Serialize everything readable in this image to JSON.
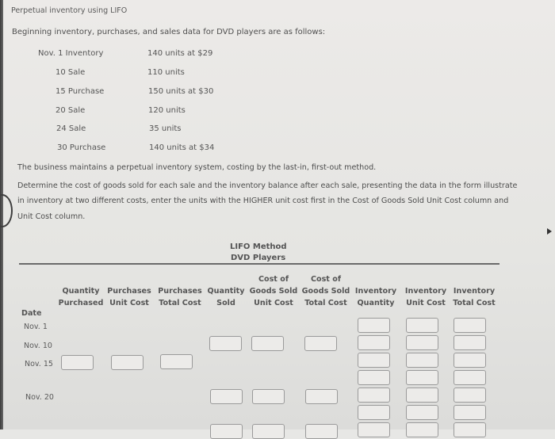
{
  "title": "Perpetual inventory using LIFO",
  "intro": "Beginning inventory, purchases, and sales data for DVD players are as follows:",
  "events": [
    {
      "date": "Nov. 1 Inventory",
      "detail": "140 units at $29"
    },
    {
      "date": "10 Sale",
      "detail": "110 units"
    },
    {
      "date": "15 Purchase",
      "detail": "150 units at $30"
    },
    {
      "date": "20 Sale",
      "detail": "120 units"
    },
    {
      "date": "24 Sale",
      "detail": "35 units"
    },
    {
      "date": "30 Purchase",
      "detail": "140 units at $34"
    }
  ],
  "paragraph1": "The business maintains a perpetual inventory system, costing by the last-in, first-out method.",
  "paragraph2_lines": [
    "Determine the cost of goods sold for each sale and the inventory balance after each sale, presenting the data in the form illustrate",
    "in inventory at two different costs, enter the units with the HIGHER unit cost first in the Cost of Goods Sold Unit Cost column and",
    "Unit Cost column."
  ],
  "table": {
    "title": "LIFO Method",
    "subtitle": "DVD Players",
    "columns": {
      "date": "Date",
      "qty_purchased": [
        "Quantity",
        "Purchased"
      ],
      "purch_unit_cost": [
        "Purchases",
        "Unit Cost"
      ],
      "purch_total_cost": [
        "Purchases",
        "Total Cost"
      ],
      "qty_sold": [
        "Quantity",
        "Sold"
      ],
      "cogs_unit_cost": [
        "Cost of",
        "Goods Sold",
        "Unit Cost"
      ],
      "cogs_total_cost": [
        "Cost of",
        "Goods Sold",
        "Total Cost"
      ],
      "inv_qty": [
        "Inventory",
        "Quantity"
      ],
      "inv_unit_cost": [
        "Inventory",
        "Unit Cost"
      ],
      "inv_total_cost": [
        "Inventory",
        "Total Cost"
      ]
    },
    "dates": [
      "Nov. 1",
      "Nov. 10",
      "Nov. 15",
      "Nov. 20"
    ],
    "inputs_value": ""
  }
}
